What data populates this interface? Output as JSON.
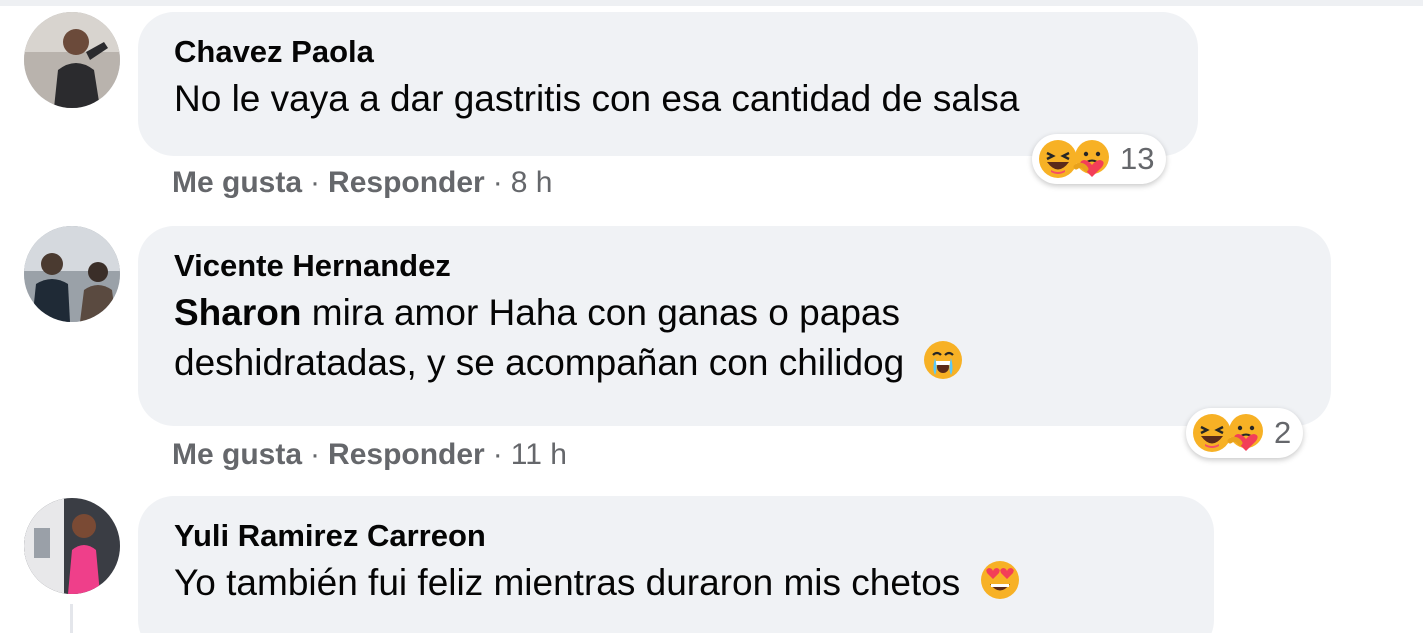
{
  "comments": [
    {
      "author": "Chavez Paola",
      "text": "No le vaya a dar gastritis con esa cantidad de salsa",
      "mention": "",
      "trailing_emoji": "",
      "reactions": [
        "haha-icon",
        "care-icon"
      ],
      "reaction_count": "13",
      "like_label": "Me gusta",
      "reply_label": "Responder",
      "separator": "·",
      "time": "8 h"
    },
    {
      "author": "Vicente Hernandez",
      "mention": "Sharon",
      "text_line1": " mira amor Haha con ganas o papas",
      "text_line2": "deshidratadas, y se acompañan con chilidog",
      "trailing_emoji": "crying-face-icon",
      "reactions": [
        "haha-icon",
        "care-icon"
      ],
      "reaction_count": "2",
      "like_label": "Me gusta",
      "reply_label": "Responder",
      "separator": "·",
      "time": "11 h"
    },
    {
      "author": "Yuli Ramirez Carreon",
      "text": "Yo también fui feliz mientras duraron mis chetos",
      "trailing_emoji": "heart-eyes-icon"
    }
  ],
  "colors": {
    "bubble": "#f0f2f5",
    "meta_text": "#65676b",
    "name_text": "#050505",
    "emoji_yellow": "#f7b125",
    "heart_red": "#f33e58"
  }
}
